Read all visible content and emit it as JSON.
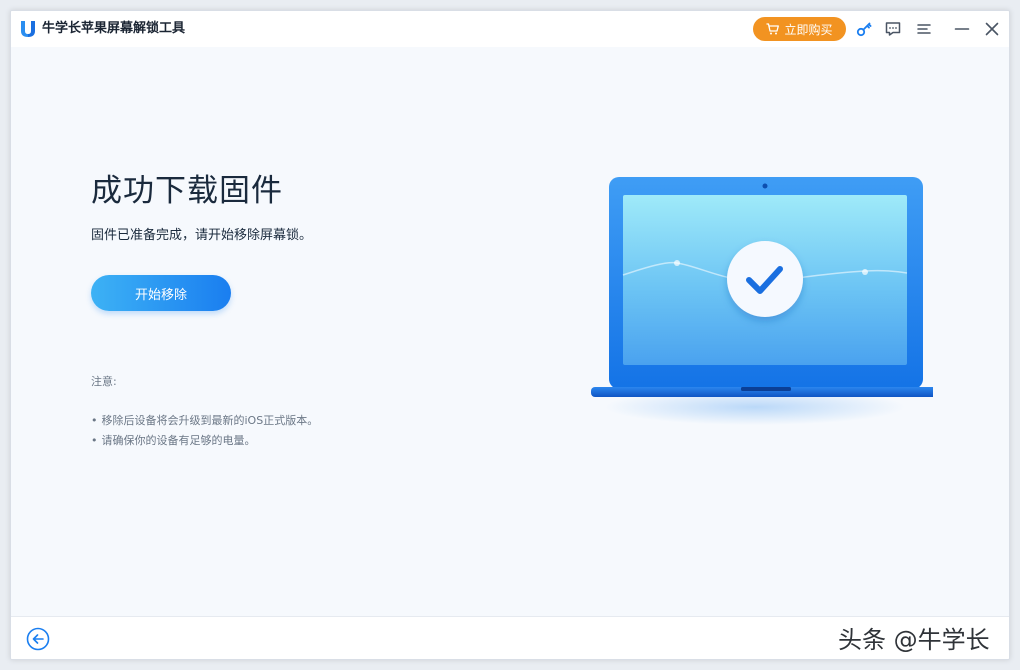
{
  "app": {
    "title": "牛学长苹果屏幕解锁工具",
    "buy_label": "立即购买",
    "accent": "#1a7ef0",
    "buy_color": "#f29321"
  },
  "titlebar_icons": [
    "key-icon",
    "feedback-icon",
    "menu-icon",
    "minimize-icon",
    "close-icon"
  ],
  "main": {
    "headline": "成功下载固件",
    "subline": "固件已准备完成，请开始移除屏幕锁。",
    "start_button": "开始移除",
    "note_title": "注意:",
    "notes": [
      "移除后设备将会升级到最新的iOS正式版本。",
      "请确保你的设备有足够的电量。"
    ]
  },
  "footer": {
    "back_icon": "back-arrow-icon"
  },
  "watermark": "头条 @牛学长"
}
